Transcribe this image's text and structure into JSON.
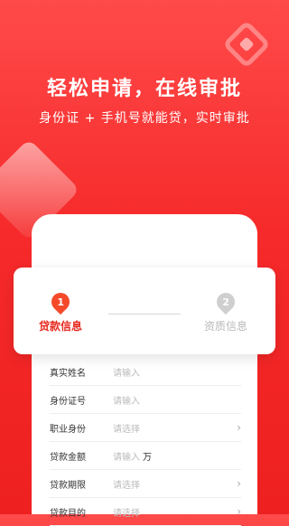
{
  "hero": {
    "title": "轻松申请，在线审批",
    "subtitle": "身份证 + 手机号就能贷，实时审批"
  },
  "steps": [
    {
      "number": "1",
      "label": "贷款信息",
      "state": "active"
    },
    {
      "number": "2",
      "label": "资质信息",
      "state": "inactive"
    }
  ],
  "form": {
    "rows": [
      {
        "label": "真实姓名",
        "placeholder": "请输入"
      },
      {
        "label": "身份证号",
        "placeholder": "请输入"
      },
      {
        "label": "职业身份",
        "placeholder": "请选择",
        "chevron": "›"
      },
      {
        "label": "贷款金额",
        "placeholder": "请输入",
        "unit": "万"
      },
      {
        "label": "贷款期限",
        "placeholder": "请选择",
        "chevron": "›"
      },
      {
        "label": "贷款目的",
        "placeholder": "请选择",
        "chevron": "›"
      }
    ]
  },
  "colors": {
    "accent": "#e8291f",
    "background": "#f62a2a",
    "inactive": "#b8b8b8"
  }
}
